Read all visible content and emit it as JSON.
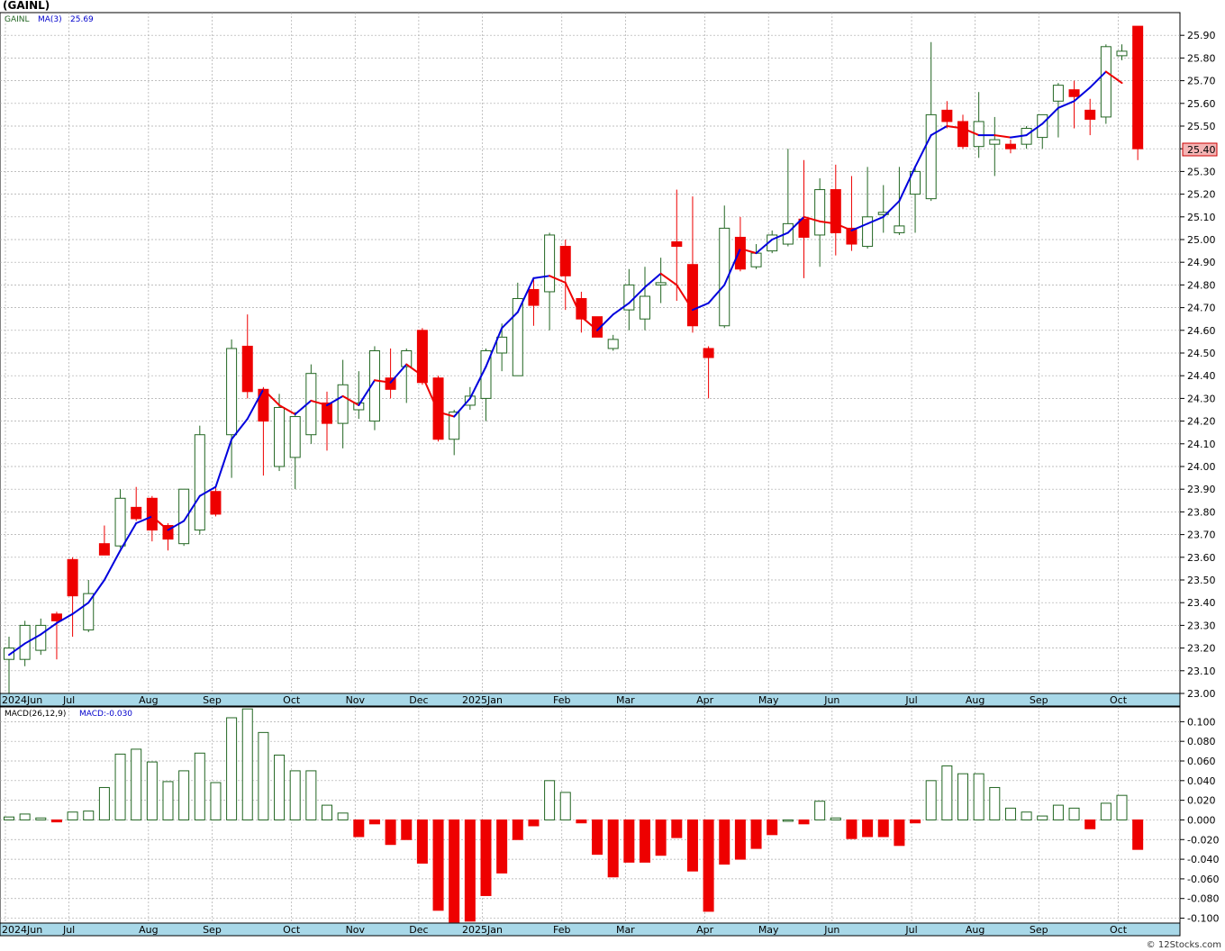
{
  "header": {
    "title": "(GAINL)",
    "symbol_label": "GAINL",
    "ma_label": "MA(3)",
    "ma_value": "25.69",
    "macd_label": "MACD(26,12,9)",
    "macd_value": "MACD:-0.030",
    "last_price": "25.40",
    "watermark": "© 12Stocks.com"
  },
  "colors": {
    "up_fill": "#ffffff",
    "up_stroke": "#226622",
    "down": "#ee0000",
    "ma_up": "#0000dd",
    "ma_down": "#ee0000",
    "axis_bar": "#a8d8e8",
    "grid": "#aaaaaa",
    "last_price_box": "#f4b4b4"
  },
  "chart_data": [
    {
      "type": "candlestick",
      "title": "(GAINL)",
      "ylim": [
        23.0,
        26.0
      ],
      "y_ticks": [
        23.0,
        23.1,
        23.2,
        23.3,
        23.4,
        23.5,
        23.6,
        23.7,
        23.8,
        23.9,
        24.0,
        24.1,
        24.2,
        24.3,
        24.4,
        24.5,
        24.6,
        24.7,
        24.8,
        24.9,
        25.0,
        25.1,
        25.2,
        25.3,
        25.4,
        25.5,
        25.6,
        25.7,
        25.8,
        25.9
      ],
      "x_labels": [
        "2024Jun",
        "Jul",
        "Aug",
        "Sep",
        "Oct",
        "Nov",
        "Dec",
        "2025Jan",
        "Feb",
        "Mar",
        "Apr",
        "May",
        "Jun",
        "Jul",
        "Aug",
        "Sep",
        "Oct"
      ],
      "x_label_weeks": [
        0,
        4,
        9,
        13,
        18,
        22,
        26,
        30,
        35,
        39,
        44,
        48,
        52,
        57,
        61,
        65,
        70
      ],
      "candles": [
        {
          "o": 23.15,
          "h": 23.25,
          "l": 23.0,
          "c": 23.2
        },
        {
          "o": 23.15,
          "h": 23.32,
          "l": 23.12,
          "c": 23.3
        },
        {
          "o": 23.19,
          "h": 23.33,
          "l": 23.17,
          "c": 23.3
        },
        {
          "o": 23.35,
          "h": 23.36,
          "l": 23.15,
          "c": 23.32
        },
        {
          "o": 23.59,
          "h": 23.6,
          "l": 23.25,
          "c": 23.43
        },
        {
          "o": 23.28,
          "h": 23.5,
          "l": 23.27,
          "c": 23.44
        },
        {
          "o": 23.66,
          "h": 23.74,
          "l": 23.62,
          "c": 23.61
        },
        {
          "o": 23.65,
          "h": 23.9,
          "l": 23.64,
          "c": 23.86
        },
        {
          "o": 23.82,
          "h": 23.91,
          "l": 23.76,
          "c": 23.77
        },
        {
          "o": 23.86,
          "h": 23.87,
          "l": 23.67,
          "c": 23.72
        },
        {
          "o": 23.74,
          "h": 23.75,
          "l": 23.63,
          "c": 23.68
        },
        {
          "o": 23.66,
          "h": 23.9,
          "l": 23.65,
          "c": 23.9
        },
        {
          "o": 23.72,
          "h": 24.18,
          "l": 23.7,
          "c": 24.14
        },
        {
          "o": 23.89,
          "h": 23.91,
          "l": 23.78,
          "c": 23.79
        },
        {
          "o": 24.14,
          "h": 24.56,
          "l": 23.95,
          "c": 24.52
        },
        {
          "o": 24.53,
          "h": 24.67,
          "l": 24.3,
          "c": 24.33
        },
        {
          "o": 24.34,
          "h": 24.35,
          "l": 23.96,
          "c": 24.2
        },
        {
          "o": 24.0,
          "h": 24.32,
          "l": 23.98,
          "c": 24.26
        },
        {
          "o": 24.04,
          "h": 24.24,
          "l": 23.9,
          "c": 24.22
        },
        {
          "o": 24.14,
          "h": 24.45,
          "l": 24.1,
          "c": 24.41
        },
        {
          "o": 24.28,
          "h": 24.33,
          "l": 24.07,
          "c": 24.19
        },
        {
          "o": 24.19,
          "h": 24.47,
          "l": 24.08,
          "c": 24.36
        },
        {
          "o": 24.25,
          "h": 24.42,
          "l": 24.21,
          "c": 24.28
        },
        {
          "o": 24.2,
          "h": 24.53,
          "l": 24.16,
          "c": 24.51
        },
        {
          "o": 24.39,
          "h": 24.52,
          "l": 24.3,
          "c": 24.34
        },
        {
          "o": 24.44,
          "h": 24.52,
          "l": 24.28,
          "c": 24.51
        },
        {
          "o": 24.6,
          "h": 24.61,
          "l": 24.36,
          "c": 24.37
        },
        {
          "o": 24.39,
          "h": 24.4,
          "l": 24.11,
          "c": 24.12
        },
        {
          "o": 24.12,
          "h": 24.25,
          "l": 24.05,
          "c": 24.24
        },
        {
          "o": 24.27,
          "h": 24.35,
          "l": 24.25,
          "c": 24.31
        },
        {
          "o": 24.3,
          "h": 24.52,
          "l": 24.2,
          "c": 24.51
        },
        {
          "o": 24.5,
          "h": 24.63,
          "l": 24.42,
          "c": 24.57
        },
        {
          "o": 24.4,
          "h": 24.81,
          "l": 24.4,
          "c": 24.74
        },
        {
          "o": 24.78,
          "h": 24.83,
          "l": 24.62,
          "c": 24.71
        },
        {
          "o": 24.77,
          "h": 25.03,
          "l": 24.6,
          "c": 25.02
        },
        {
          "o": 24.97,
          "h": 25.0,
          "l": 24.69,
          "c": 24.84
        },
        {
          "o": 24.74,
          "h": 24.77,
          "l": 24.59,
          "c": 24.65
        },
        {
          "o": 24.66,
          "h": 24.66,
          "l": 24.57,
          "c": 24.57
        },
        {
          "o": 24.52,
          "h": 24.58,
          "l": 24.51,
          "c": 24.56
        },
        {
          "o": 24.69,
          "h": 24.87,
          "l": 24.6,
          "c": 24.8
        },
        {
          "o": 24.65,
          "h": 24.88,
          "l": 24.6,
          "c": 24.75
        },
        {
          "o": 24.8,
          "h": 24.92,
          "l": 24.72,
          "c": 24.81
        },
        {
          "o": 24.99,
          "h": 25.22,
          "l": 24.73,
          "c": 24.97
        },
        {
          "o": 24.89,
          "h": 25.19,
          "l": 24.59,
          "c": 24.62
        },
        {
          "o": 24.52,
          "h": 24.53,
          "l": 24.3,
          "c": 24.48
        },
        {
          "o": 24.62,
          "h": 25.15,
          "l": 24.61,
          "c": 25.05
        },
        {
          "o": 25.01,
          "h": 25.1,
          "l": 24.86,
          "c": 24.87
        },
        {
          "o": 24.88,
          "h": 24.98,
          "l": 24.87,
          "c": 24.94
        },
        {
          "o": 24.95,
          "h": 25.04,
          "l": 24.94,
          "c": 25.02
        },
        {
          "o": 24.98,
          "h": 25.4,
          "l": 24.97,
          "c": 25.07
        },
        {
          "o": 25.09,
          "h": 25.35,
          "l": 24.83,
          "c": 25.01
        },
        {
          "o": 25.02,
          "h": 25.27,
          "l": 24.88,
          "c": 25.22
        },
        {
          "o": 25.22,
          "h": 25.33,
          "l": 24.93,
          "c": 25.03
        },
        {
          "o": 25.05,
          "h": 25.28,
          "l": 24.95,
          "c": 24.98
        },
        {
          "o": 24.97,
          "h": 25.32,
          "l": 24.96,
          "c": 25.1
        },
        {
          "o": 25.11,
          "h": 25.24,
          "l": 25.03,
          "c": 25.12
        },
        {
          "o": 25.03,
          "h": 25.32,
          "l": 25.02,
          "c": 25.06
        },
        {
          "o": 25.2,
          "h": 25.32,
          "l": 25.03,
          "c": 25.3
        },
        {
          "o": 25.18,
          "h": 25.87,
          "l": 25.17,
          "c": 25.55
        },
        {
          "o": 25.57,
          "h": 25.61,
          "l": 25.49,
          "c": 25.52
        },
        {
          "o": 25.52,
          "h": 25.55,
          "l": 25.4,
          "c": 25.41
        },
        {
          "o": 25.41,
          "h": 25.65,
          "l": 25.36,
          "c": 25.52
        },
        {
          "o": 25.42,
          "h": 25.54,
          "l": 25.28,
          "c": 25.44
        },
        {
          "o": 25.42,
          "h": 25.44,
          "l": 25.38,
          "c": 25.4
        },
        {
          "o": 25.42,
          "h": 25.5,
          "l": 25.4,
          "c": 25.49
        },
        {
          "o": 25.45,
          "h": 25.55,
          "l": 25.4,
          "c": 25.55
        },
        {
          "o": 25.61,
          "h": 25.69,
          "l": 25.45,
          "c": 25.68
        },
        {
          "o": 25.66,
          "h": 25.7,
          "l": 25.49,
          "c": 25.63
        },
        {
          "o": 25.57,
          "h": 25.62,
          "l": 25.46,
          "c": 25.53
        },
        {
          "o": 25.54,
          "h": 25.86,
          "l": 25.51,
          "c": 25.85
        },
        {
          "o": 25.81,
          "h": 25.86,
          "l": 25.79,
          "c": 25.83
        },
        {
          "o": 25.94,
          "h": 25.94,
          "l": 25.35,
          "c": 25.4
        }
      ],
      "ma3": [
        23.17,
        23.22,
        23.26,
        23.31,
        23.35,
        23.4,
        23.5,
        23.63,
        23.75,
        23.78,
        23.72,
        23.76,
        23.87,
        23.91,
        24.12,
        24.21,
        24.34,
        24.27,
        24.23,
        24.29,
        24.27,
        24.31,
        24.27,
        24.38,
        24.37,
        24.45,
        24.4,
        24.24,
        24.22,
        24.3,
        24.44,
        24.61,
        24.68,
        24.83,
        24.84,
        24.81,
        24.66,
        24.6,
        24.67,
        24.72,
        24.79,
        24.85,
        24.8,
        24.69,
        24.72,
        24.8,
        24.96,
        24.94,
        25.0,
        25.03,
        25.1,
        25.08,
        25.07,
        25.04,
        25.07,
        25.1,
        25.17,
        25.32,
        25.46,
        25.5,
        25.49,
        25.46,
        25.46,
        25.45,
        25.46,
        25.51,
        25.58,
        25.61,
        25.67,
        25.74,
        25.69
      ]
    },
    {
      "type": "bar",
      "title": "MACD(26,12,9)",
      "ylim": [
        -0.105,
        0.115
      ],
      "y_ticks": [
        -0.1,
        -0.08,
        -0.06,
        -0.04,
        -0.02,
        0.0,
        0.02,
        0.04,
        0.06,
        0.08,
        0.1
      ],
      "y_tick_labels": [
        "-0.100",
        "-0.080",
        "-0.060",
        "-0.040",
        "-0.020",
        "0.000",
        "0.020",
        "0.040",
        "0.060",
        "0.080",
        "0.100"
      ],
      "x_labels": [
        "2024Jun",
        "Jul",
        "Aug",
        "Sep",
        "Oct",
        "Nov",
        "Dec",
        "2025Jan",
        "Feb",
        "Mar",
        "Apr",
        "May",
        "Jun",
        "Jul",
        "Aug",
        "Sep",
        "Oct"
      ],
      "x_label_weeks": [
        0,
        4,
        9,
        13,
        18,
        22,
        26,
        30,
        35,
        39,
        44,
        48,
        52,
        57,
        61,
        65,
        70
      ],
      "values": [
        0.003,
        0.006,
        0.002,
        -0.002,
        0.008,
        0.009,
        0.033,
        0.067,
        0.072,
        0.059,
        0.039,
        0.05,
        0.068,
        0.038,
        0.104,
        0.113,
        0.089,
        0.066,
        0.05,
        0.05,
        0.015,
        0.007,
        -0.017,
        -0.004,
        -0.025,
        -0.02,
        -0.044,
        -0.092,
        -0.104,
        -0.103,
        -0.077,
        -0.054,
        -0.02,
        -0.006,
        0.04,
        0.028,
        -0.003,
        -0.035,
        -0.058,
        -0.043,
        -0.043,
        -0.036,
        -0.018,
        -0.052,
        -0.093,
        -0.045,
        -0.04,
        -0.029,
        -0.015,
        0.0,
        -0.004,
        0.019,
        0.002,
        -0.019,
        -0.017,
        -0.017,
        -0.026,
        -0.003,
        0.04,
        0.055,
        0.047,
        0.047,
        0.033,
        0.012,
        0.008,
        0.004,
        0.015,
        0.012,
        -0.009,
        0.017,
        0.025,
        -0.03
      ]
    }
  ]
}
